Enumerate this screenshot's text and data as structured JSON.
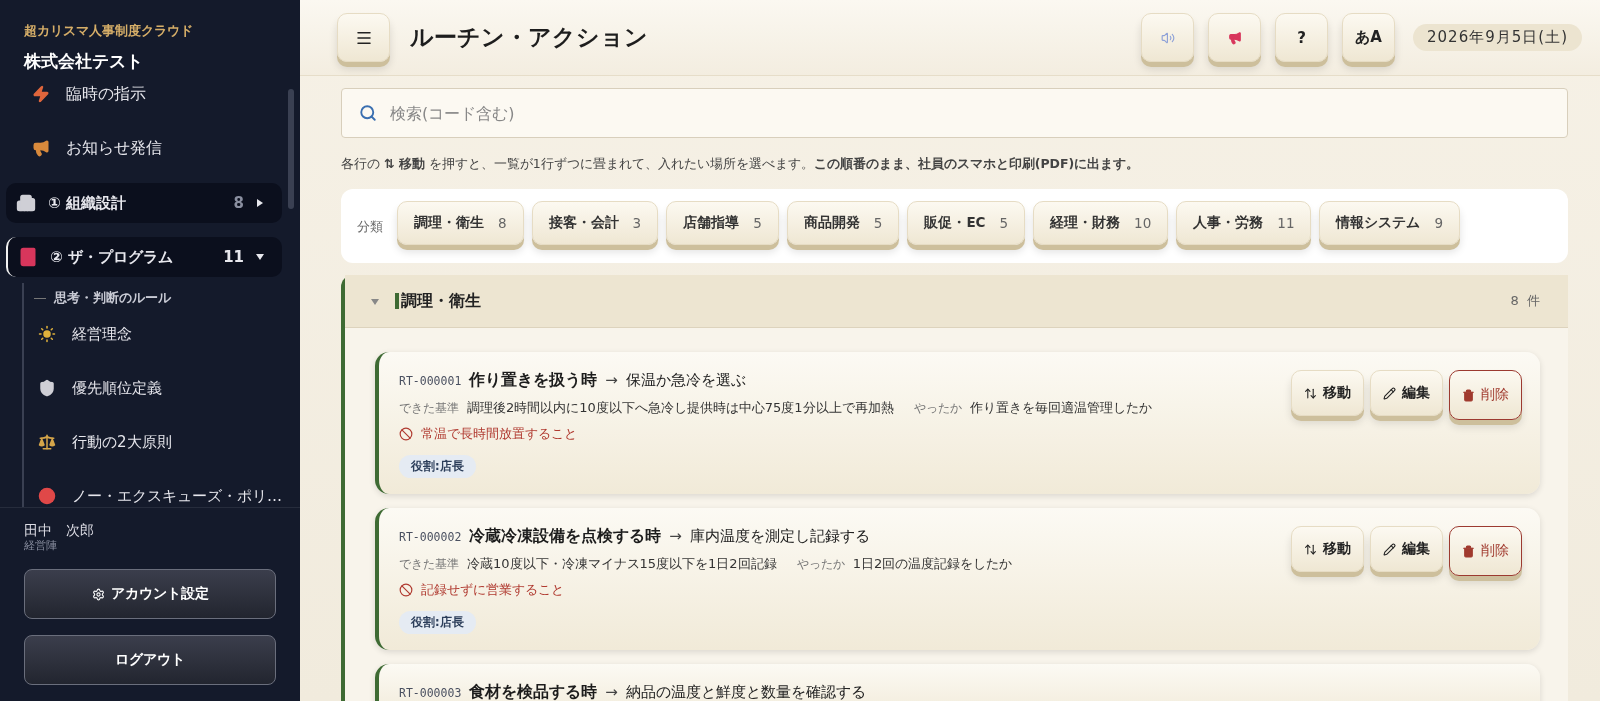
{
  "sidebar": {
    "app_name": "超カリスマ人事制度クラウド",
    "company": "株式会社テスト",
    "nav": [
      {
        "kind": "link",
        "label": "臨時の指示"
      },
      {
        "kind": "link",
        "label": "お知らせ発信"
      },
      {
        "kind": "section",
        "label": "① 組織設計",
        "count": "8",
        "expanded": false,
        "selected": false
      },
      {
        "kind": "section",
        "label": "② ザ・プログラム",
        "count": "11",
        "expanded": true,
        "selected": true,
        "children": [
          {
            "kind": "heading",
            "label": "思考・判断のルール"
          },
          {
            "kind": "link",
            "label": "経営理念"
          },
          {
            "kind": "link",
            "label": "優先順位定義"
          },
          {
            "kind": "link",
            "label": "行動の2大原則"
          },
          {
            "kind": "link",
            "label": "ノー・エクスキューズ・ポリ…"
          }
        ]
      }
    ],
    "user": {
      "name": "田中　次郎",
      "role": "経営陣"
    },
    "buttons": [
      {
        "kind": "settings",
        "label": "アカウント設定"
      },
      {
        "kind": "logout",
        "label": "ログアウト"
      }
    ]
  },
  "topbar": {
    "title": "ルーチン・アクション",
    "buttons": [
      {
        "kind": "speaker"
      },
      {
        "kind": "megaphone"
      },
      {
        "kind": "text",
        "label": "?"
      },
      {
        "kind": "text",
        "label": "あA"
      }
    ],
    "date": "2026年9月5日(土)"
  },
  "search": {
    "placeholder": "検索(コード含む)"
  },
  "hint": "各行の **⇅ 移動** を押すと、一覧が1行ずつに畳まれて、入れたい場所を選べます。**この順番のまま、社員のスマホと印刷(PDF)に出ます。**",
  "filter": {
    "label": "分類",
    "chips": [
      {
        "label": "調理・衛生",
        "count": "8"
      },
      {
        "label": "接客・会計",
        "count": "3"
      },
      {
        "label": "店舗指導",
        "count": "5"
      },
      {
        "label": "商品開発",
        "count": "5"
      },
      {
        "label": "販促・EC",
        "count": "5"
      },
      {
        "label": "経理・財務",
        "count": "10"
      },
      {
        "label": "人事・労務",
        "count": "11"
      },
      {
        "label": "情報システム",
        "count": "9"
      }
    ]
  },
  "group": {
    "title": "調理・衛生",
    "count": "8 件",
    "expanded": true,
    "cards": [
      {
        "code": "RT-000001",
        "situation": "作り置きを扱う時",
        "arrow": "→",
        "action": "保温か急冷を選ぶ",
        "criteria_label": "できた基準",
        "criteria": "調理後2時間以内に10度以下へ急冷し提供時は中心75度1分以上で再加熱",
        "check_label": "やったか",
        "check": "作り置きを毎回適温管理したか",
        "prohibition": "常温で長時間放置すること",
        "role": "役割:店長",
        "actions": [
          {
            "kind": "move",
            "label": "移動"
          },
          {
            "kind": "edit",
            "label": "編集"
          },
          {
            "kind": "delete",
            "label": "削除"
          }
        ]
      },
      {
        "code": "RT-000002",
        "situation": "冷蔵冷凍設備を点検する時",
        "arrow": "→",
        "action": "庫内温度を測定し記録する",
        "criteria_label": "できた基準",
        "criteria": "冷蔵10度以下・冷凍マイナス15度以下を1日2回記録",
        "check_label": "やったか",
        "check": "1日2回の温度記録をしたか",
        "prohibition": "記録せずに営業すること",
        "role": "役割:店長",
        "actions": [
          {
            "kind": "move",
            "label": "移動"
          },
          {
            "kind": "edit",
            "label": "編集"
          },
          {
            "kind": "delete",
            "label": "削除"
          }
        ]
      },
      {
        "code": "RT-000003",
        "situation": "食材を検品する時",
        "arrow": "→",
        "action": "納品の温度と鮮度と数量を確認する"
      }
    ]
  }
}
